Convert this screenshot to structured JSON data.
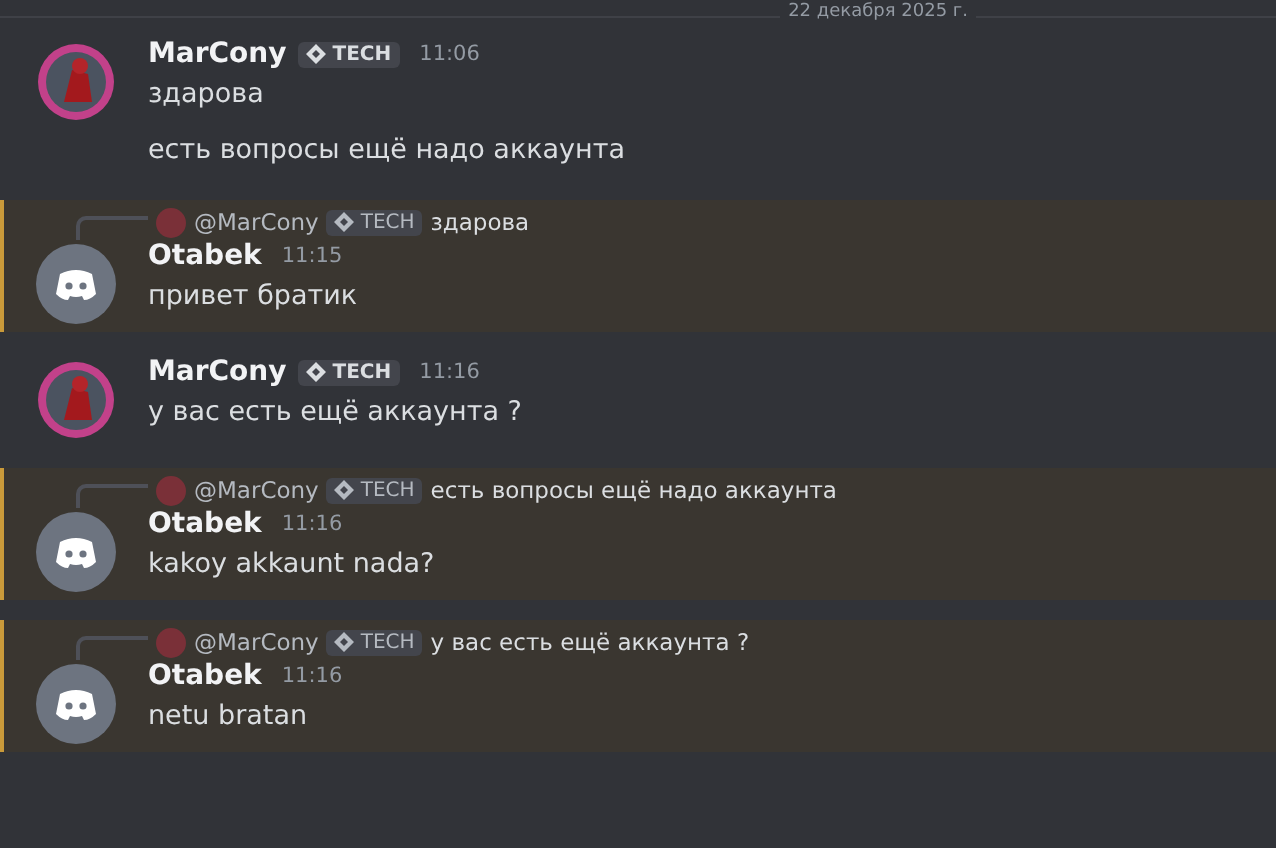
{
  "date_divider": "22 декабря 2025 г.",
  "messages": [
    {
      "author": "MarCony",
      "kind": "user",
      "tag": "TECH",
      "time": "11:06",
      "highlighted": false,
      "lines": [
        "здарова",
        "есть вопросы ещё надо аккаунта"
      ]
    },
    {
      "author": "Otabek",
      "kind": "default",
      "time": "11:15",
      "highlighted": true,
      "reply": {
        "author": "@MarCony",
        "tag": "TECH",
        "text": "здарова"
      },
      "lines": [
        "привет братик"
      ]
    },
    {
      "author": "MarCony",
      "kind": "user",
      "tag": "TECH",
      "time": "11:16",
      "highlighted": false,
      "lines": [
        "у вас есть ещё аккаунта ?"
      ]
    },
    {
      "author": "Otabek",
      "kind": "default",
      "time": "11:16",
      "highlighted": true,
      "reply": {
        "author": "@MarCony",
        "tag": "TECH",
        "text": "есть вопросы ещё надо аккаунта"
      },
      "lines": [
        "kakoy akkaunt nada?"
      ]
    },
    {
      "author": "Otabek",
      "kind": "default",
      "time": "11:16",
      "highlighted": true,
      "reply": {
        "author": "@MarCony",
        "tag": "TECH",
        "text": "у вас есть ещё аккаунта ?"
      },
      "lines": [
        "netu bratan"
      ]
    }
  ]
}
